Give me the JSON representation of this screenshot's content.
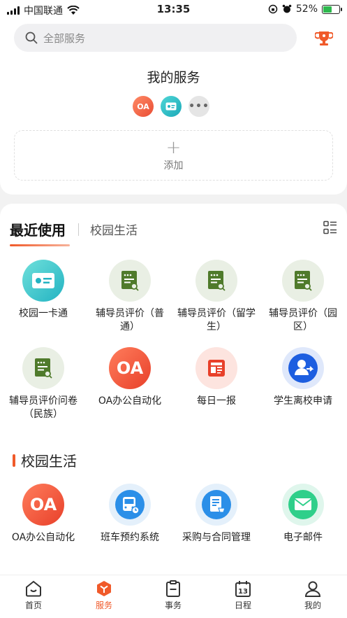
{
  "status": {
    "carrier": "中国联通",
    "time": "13:35",
    "battery": "52%"
  },
  "search": {
    "placeholder": "全部服务"
  },
  "my_services": {
    "title": "我的服务",
    "mini_icons": [
      "OA",
      "card-icon",
      "more-icon"
    ],
    "add_label": "添加"
  },
  "tabs": {
    "active": "最近使用",
    "other": "校园生活"
  },
  "recent_apps": [
    {
      "label": "校园一卡通",
      "icon": "card-icon"
    },
    {
      "label": "辅导员评价（普通）",
      "icon": "doc-icon"
    },
    {
      "label": "辅导员评价（留学生）",
      "icon": "doc-icon"
    },
    {
      "label": "辅导员评价（园区）",
      "icon": "doc-icon"
    },
    {
      "label": "辅导员评价问卷（民族）",
      "icon": "doc-icon"
    },
    {
      "label": "OA办公自动化",
      "icon": "oa-icon"
    },
    {
      "label": "每日一报",
      "icon": "news-icon"
    },
    {
      "label": "学生离校申请",
      "icon": "leave-icon"
    }
  ],
  "campus_life": {
    "title": "校园生活",
    "apps": [
      {
        "label": "OA办公自动化",
        "icon": "oa-icon"
      },
      {
        "label": "班车预约系统",
        "icon": "bus-icon"
      },
      {
        "label": "采购与合同管理",
        "icon": "purchase-icon"
      },
      {
        "label": "电子邮件",
        "icon": "mail-icon"
      }
    ]
  },
  "oa_text": "OA",
  "bottom_nav": [
    {
      "label": "首页"
    },
    {
      "label": "服务"
    },
    {
      "label": "事务"
    },
    {
      "label": "日程"
    },
    {
      "label": "我的"
    }
  ],
  "calendar_day": "13",
  "colors": {
    "accent": "#f05a2a",
    "battery": "#2db84d"
  }
}
